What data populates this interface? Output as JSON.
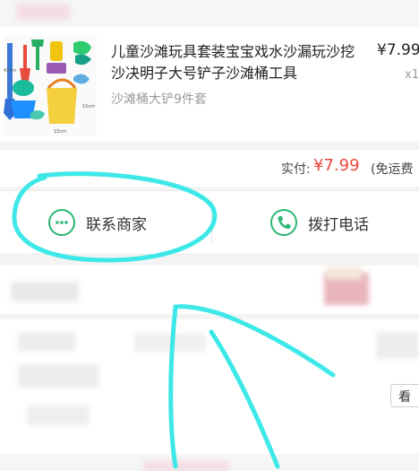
{
  "order": {
    "product_title": "儿童沙滩玩具套装宝宝戏水沙漏玩沙挖沙决明子大号铲子沙滩桶工具",
    "sku": "沙滩桶大铲9件套",
    "price": "¥7.99",
    "quantity": "x1",
    "thumb_labels": {
      "height": "41cm",
      "width_a": "15cm",
      "width_b": "15cm"
    }
  },
  "total": {
    "label": "实付:",
    "amount": "¥7.99",
    "shipping": "(免运费"
  },
  "actions": {
    "contact_label": "联系商家",
    "call_label": "拨打电话"
  },
  "lower": {
    "see_label": "看"
  },
  "colors": {
    "accent_green": "#2bb673",
    "price_red": "#e8473e",
    "annotation_cyan": "#3ee8e8"
  },
  "icons": {
    "contact": "chat-bubble-icon",
    "call": "phone-icon"
  }
}
